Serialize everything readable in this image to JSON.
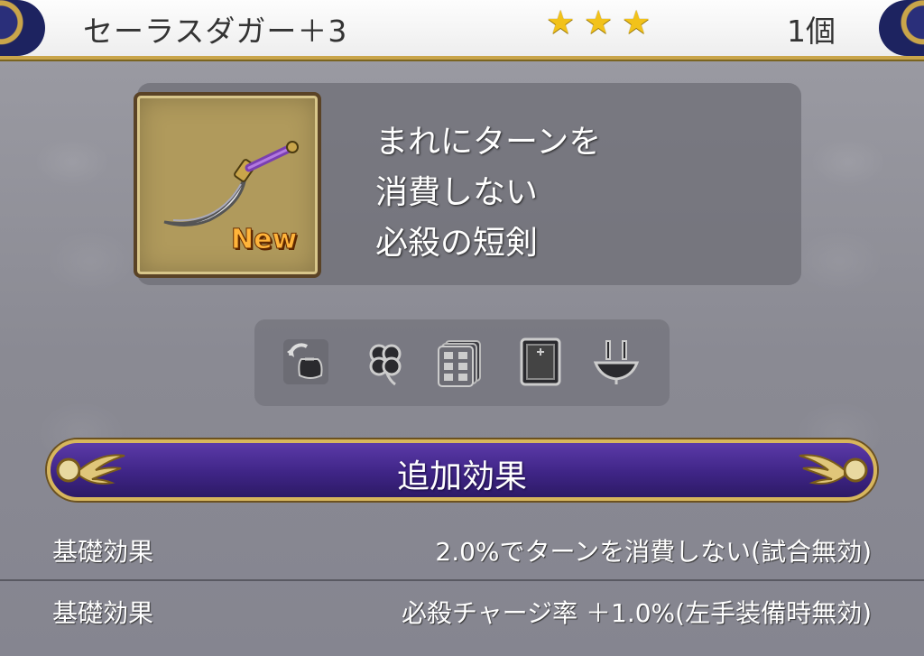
{
  "header": {
    "item_name": "セーラスダガー＋3",
    "star_count": 3,
    "count_label": "1個"
  },
  "item": {
    "new_badge": "New",
    "icon": "curved-dagger-icon",
    "description_lines": [
      "まれにターンを",
      "消費しない",
      "必殺の短剣"
    ]
  },
  "icon_strip": {
    "icons": [
      "bag-swap-icon",
      "clover-icon",
      "cards-icon",
      "book-icon",
      "trophy-icon"
    ]
  },
  "effects": {
    "banner_label": "追加効果",
    "rows": [
      {
        "label": "基礎効果",
        "value": "2.0%でターンを消費しない(試合無効)"
      },
      {
        "label": "基礎効果",
        "value": "必殺チャージ率 ＋1.0%(左手装備時無効)"
      }
    ]
  },
  "colors": {
    "star": "#f2c21a",
    "banner": "#3f2586",
    "gold_border": "#d7b65c"
  }
}
